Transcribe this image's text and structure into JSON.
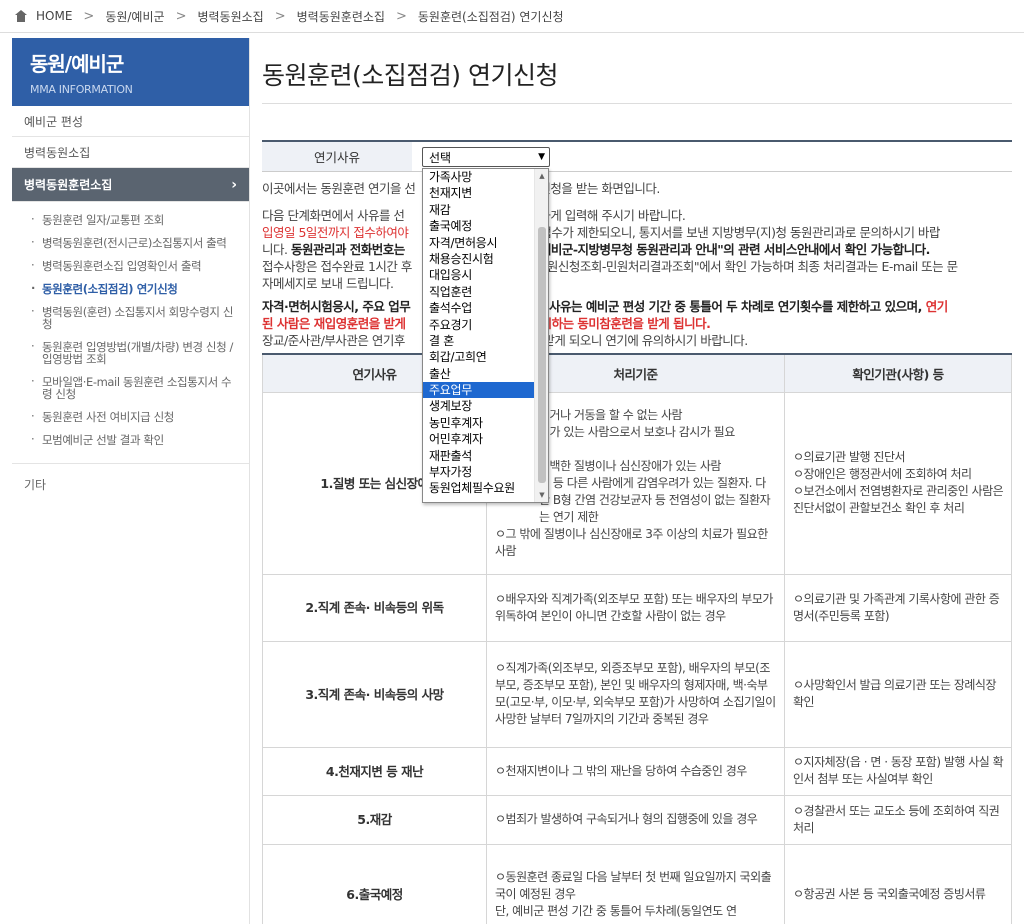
{
  "breadcrumb": [
    "HOME",
    "동원/예비군",
    "병력동원소집",
    "병력동원훈련소집",
    "동원훈련(소집점검) 연기신청"
  ],
  "sidebar": {
    "title": "동원/예비군",
    "subtitle": "MMA INFORMATION",
    "menu": [
      "예비군 편성",
      "병력동원소집",
      "병력동원훈련소집"
    ],
    "submenu": [
      "동원훈련 일자/교통편 조회",
      "병력동원훈련(전시근로)소집통지서 출력",
      "병력동원훈련소집 입영확인서 출력",
      "동원훈련(소집점검) 연기신청",
      "병력동원(훈련) 소집통지서 회망수령지 신청",
      "동원훈련 입영방법(개별/차량) 변경 신청 / 입영방법 조회",
      "모바일앱·E-mail 동원훈련 소집통지서 수령 신청",
      "동원훈련 사전 여비지급 신청",
      "모범예비군 선발 결과 확인"
    ],
    "etc": "기타"
  },
  "page": {
    "title": "동원훈련(소집점검) 연기신청",
    "reason_label": "연기사유",
    "select_value": "선택"
  },
  "info": {
    "p1a": "이곳에서는 동원훈련 연기을 선",
    "p1b": "신청을 받는 화면입니다.",
    "p2a": "다음 단계화면에서 사유를 선",
    "p2b": "확하게 입력해 주시기 바랍니다.",
    "p3a": "입영일 5일전까지 접수하여야",
    "p3b": "! 접수가 제한되오니, 통지서를 보낸 지방병무(지)청 동원관리과로 문의하시기 바랍",
    "p3c": "니다. ",
    "p3d": "동원관리과 전화번호는",
    "p3e": "편예비군-지방병무청 동원관리과 안내\"의 관련 서비스안내에서 확인 가능합니다.",
    "p3f": "접수사항은 접수완료 1시간 후",
    "p3g": "민원신청조회-민원처리결과조회\"에서 확인 가능하며 최종 처리결과는 E-mail 또는 문",
    "p3h": "자메세지로 보내 드립니다.",
    "p4a": "자격·면허시험응시, 주요 업무",
    "p4b": "정 사유는 예비군 편성 기간 중 통틀어 두 차례로 연기횟수를 제한하고 있으며, ",
    "p4c": "연기",
    "p4d": "된 사람은 재입영훈련을 받게",
    "p4e": "실시하는 동미참훈련을 받게 됩니다.",
    "p5a": "장교/준사관/부사관은 연기후",
    "p5b": "을 받게 되오니 연기에 유의하시기 바랍니다."
  },
  "table": {
    "headers": [
      "연기사유",
      "처리기준",
      "확인기관(사항) 등"
    ],
    "rows": [
      {
        "reason": "1.질병 또는 심신장애",
        "criteria": [
          "이거나 거동을 할 수 없는 사람",
          "애가 있는 사람으로서 보호나 감시가 필요",
          "",
          "명백한 질병이나 심신장애가 있는 사람",
          "병 등 다른 사람에게 감염우려가 있는 질환자. 다만 B형 간염 건강보균자 등 전염성이 없는 질환자는 연기 제한",
          "ㅇ그 밖에 질병이나 심신장애로 3주 이상의 치료가 필요한 사람"
        ],
        "confirm": [
          "ㅇ의료기관 발행 진단서",
          "ㅇ장애인은 행정관서에 조회하여 처리",
          "ㅇ보건소에서 전염병환자로 관리중인 사람은 진단서없이 관할보건소 확인 후 처리"
        ]
      },
      {
        "reason": "2.직계 존속· 비속등의 위독",
        "criteria": [
          "ㅇ배우자와 직계가족(외조부모 포함) 또는 배우자의 부모가 위독하여 본인이 아니면 간호할 사람이 없는 경우"
        ],
        "confirm": [
          "ㅇ의료기관 및 가족관계 기록사항에 관한 증명서(주민등록 포함)"
        ]
      },
      {
        "reason": "3.직계 존속· 비속등의 사망",
        "criteria": [
          "ㅇ직계가족(외조부모, 외증조부모 포함), 배우자의 부모(조부모, 증조부모 포함), 본인 및 배우자의 형제자매, 백·숙부모(고모·부, 이모·부, 외숙부모 포함)가 사망하여 소집기일이 사망한 날부터 7일까지의 기간과 중복된 경우"
        ],
        "confirm": [
          "ㅇ사망확인서 발급 의료기관 또는 장례식장 확인"
        ]
      },
      {
        "reason": "4.천재지변 등 재난",
        "criteria": [
          "ㅇ천재지변이나 그 밖의 재난을 당하여 수습중인 경우"
        ],
        "confirm": [
          "ㅇ지자체장(읍 · 면 · 동장 포함) 발행 사실 확인서 첨부 또는 사실여부 확인"
        ]
      },
      {
        "reason": "5.재감",
        "criteria": [
          "ㅇ범죄가 발생하여 구속되거나 형의 집행중에 있을 경우"
        ],
        "confirm": [
          "ㅇ경찰관서 또는 교도소 등에 조회하여 직권 처리"
        ]
      },
      {
        "reason": "6.출국예정",
        "criteria": [
          "ㅇ동원훈련 종료일 다음 날부터 첫 번째 일요일까지 국외출국이 예정된 경우",
          "단, 예비군 편성 기간 중 통틀어 두차례(동일연도 연"
        ],
        "confirm": [
          "ㅇ항공권 사본 등 국외출국예정 증빙서류"
        ]
      }
    ]
  },
  "dropdown": {
    "options": [
      "가족사망",
      "천재지변",
      "재감",
      "출국예정",
      "자격/면허응시",
      "채용승진시험",
      "대입응시",
      "직업훈련",
      "출석수업",
      "주요경기",
      "결 혼",
      "회갑/고희연",
      "출산",
      "주요업무",
      "생계보장",
      "농민후계자",
      "어민후계자",
      "재판출석",
      "부자가정",
      "동원업체필수요원"
    ],
    "highlighted": "주요업무"
  },
  "colors": {
    "sidebar_header": "#2f5fa7",
    "active_menu": "#5a6470",
    "highlight": "#1e68d0",
    "warning_red": "#d33333"
  }
}
